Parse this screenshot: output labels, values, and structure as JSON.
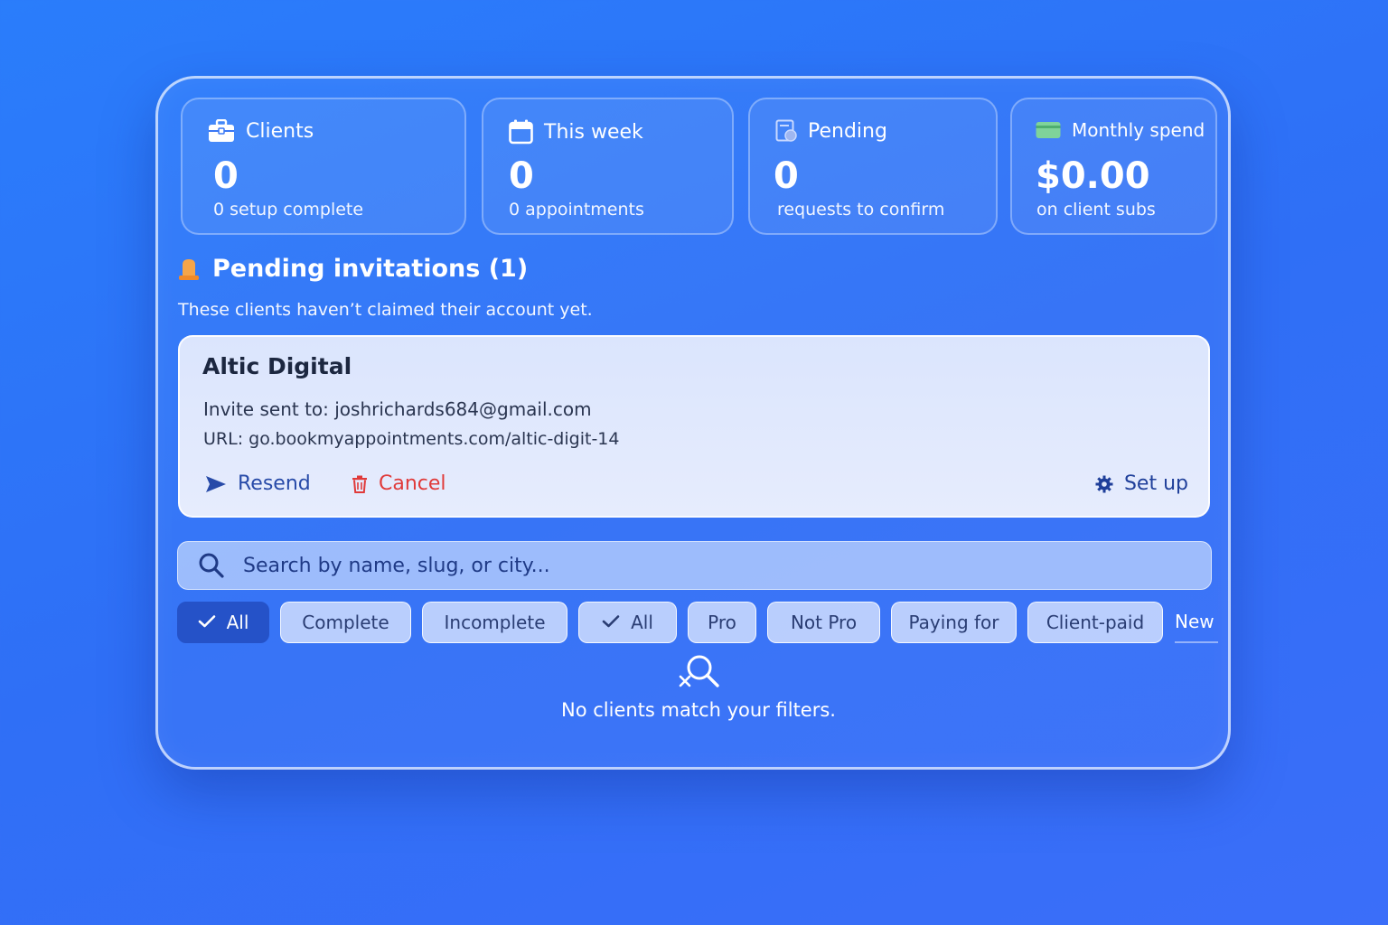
{
  "stats": [
    {
      "label": "Clients",
      "value": "0",
      "sub": "0 setup complete",
      "icon": "briefcase-icon"
    },
    {
      "label": "This week",
      "value": "0",
      "sub": "0 appointments",
      "icon": "calendar-icon"
    },
    {
      "label": "Pending",
      "value": "0",
      "sub": "requests to confirm",
      "icon": "pending-doc-icon"
    },
    {
      "label": "Monthly spend",
      "value": "$0.00",
      "sub": "on client subs",
      "icon": "credit-card-icon"
    }
  ],
  "pending_invitations": {
    "title": "Pending invitations (1)",
    "description": "These clients haven’t claimed their account yet.",
    "icon": "bell-icon",
    "invites": [
      {
        "name": "Altic Digital",
        "email_line": "Invite sent to: joshrichards684@gmail.com",
        "url_line": "URL: go.bookmyappointments.com/altic-digit-14",
        "resend_label": "Resend",
        "cancel_label": "Cancel",
        "setup_label": "Set up"
      }
    ]
  },
  "search": {
    "placeholder": "Search by name, slug, or city...",
    "value": ""
  },
  "filters": [
    {
      "label": "All",
      "active": true,
      "checked": true
    },
    {
      "label": "Complete",
      "active": false
    },
    {
      "label": "Incomplete",
      "active": false
    },
    {
      "label": "All",
      "active": false,
      "checked": true
    },
    {
      "label": "Pro",
      "active": false
    },
    {
      "label": "Not Pro",
      "active": false
    },
    {
      "label": "Paying for",
      "active": false
    },
    {
      "label": "Client-paid",
      "active": false
    },
    {
      "label": "New",
      "active": false
    }
  ],
  "empty_state": {
    "text": "No clients match your filters.",
    "icon": "search-x-icon"
  },
  "colors": {
    "background": "#2a7dfb",
    "active_chip": "#2552c8",
    "cancel": "#e03a3a",
    "action": "#274aa8",
    "pending_icon": "#f5a54a",
    "card_icon": "#7fd39a"
  }
}
